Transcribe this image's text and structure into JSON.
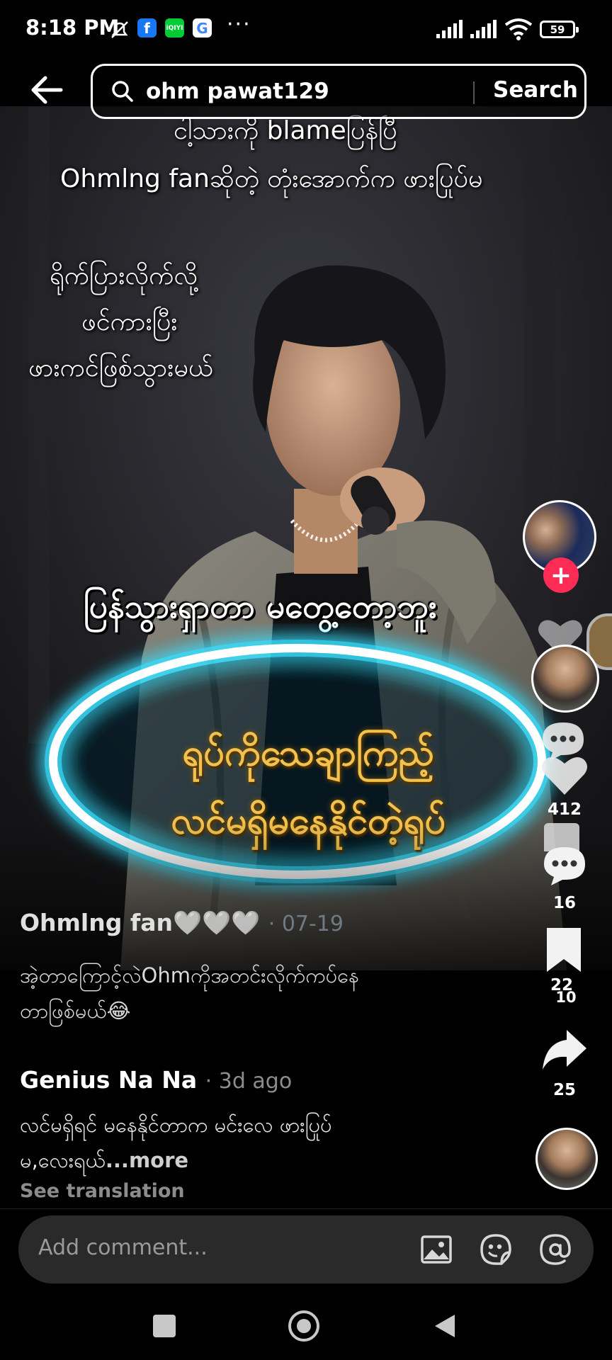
{
  "status_bar": {
    "time": "8:18 PM",
    "battery": "59",
    "more_dots": "···",
    "app_icons": [
      "facebook-icon",
      "iqiyi-icon",
      "google-icon"
    ]
  },
  "search": {
    "query": "ohm pawat129",
    "button_label": "Search"
  },
  "video": {
    "caption_lines_top": [
      "ငါ့သားကို blameပြန်ပြီ",
      "Ohmlng fanဆိုတဲ့ တုံးအောက်က ဖားပြုပ်မ"
    ],
    "caption_lines_left": [
      "ရိုက်ပြားလိုက်လို့",
      "ဖင်ကားပြီး",
      "ဖားကင်ဖြစ်သွားမယ်"
    ],
    "caption_middle": "ပြန်သွားရှာတာ မတွေ့တော့ဘူး",
    "oval_text": [
      "ရုပ်ကိုသေချာကြည့်",
      "လင်မရှိမနေနိုင်တဲ့ရုပ်"
    ]
  },
  "actions": {
    "likes": "412",
    "comments": "16",
    "saves": "22",
    "saves_overlap": "10",
    "shares": "25"
  },
  "comments": [
    {
      "author": "Ohmlng fan",
      "hearts": "🤍🤍🤍",
      "date": "· 07-19",
      "text": [
        "အဲ့တာကြောင့်လဲOhmကိုအတင်းလိုက်ကပ်နေ",
        "တာဖြစ်မယ်😂"
      ]
    },
    {
      "author": "Genius Na Na",
      "date": "· 3d ago",
      "text": [
        "လင်မရှိရင် မနေနိုင်တာက မင်းလေ ဖားပြုပ်",
        "မ,လေးရယ်"
      ],
      "more": "...more",
      "see_translation": "See translation"
    }
  ],
  "comment_input": {
    "placeholder": "Add comment..."
  },
  "colors": {
    "like_pink": "#fe2c55",
    "oval_glow": "#38e0ff",
    "oval_text": "#f2c14e"
  }
}
